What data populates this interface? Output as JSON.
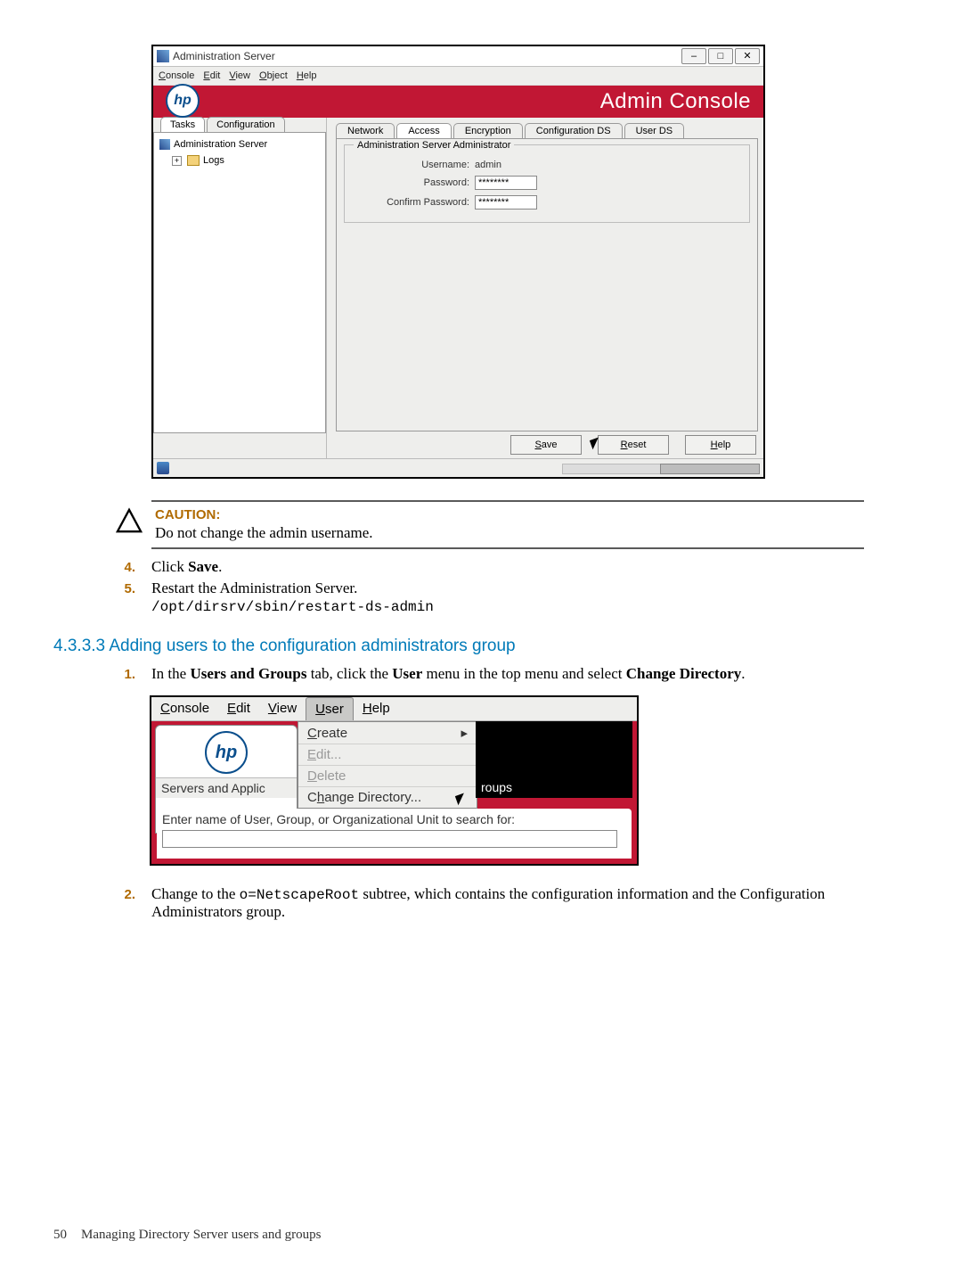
{
  "screenshot1": {
    "window_title": "Administration Server",
    "menubar": [
      "Console",
      "Edit",
      "View",
      "Object",
      "Help"
    ],
    "menubar_ul": [
      "C",
      "E",
      "V",
      "O",
      "H"
    ],
    "banner_text": "Admin Console",
    "side_tabs": {
      "active": "Tasks",
      "other": "Configuration"
    },
    "tree": {
      "root": "Administration Server",
      "child": "Logs"
    },
    "right_tabs": [
      "Network",
      "Access",
      "Encryption",
      "Configuration DS",
      "User DS"
    ],
    "fieldset_legend": "Administration Server Administrator",
    "username_label": "Username:",
    "username_value": "admin",
    "password_label": "Password:",
    "password_value": "********",
    "confirm_label": "Confirm Password:",
    "confirm_value": "********",
    "buttons": {
      "save": "Save",
      "reset": "Reset",
      "help": "Help"
    }
  },
  "caution": {
    "heading": "CAUTION:",
    "body": "Do not change the admin username."
  },
  "steps_a": {
    "s4_num": "4.",
    "s4_pre": "Click ",
    "s4_bold": "Save",
    "s4_post": ".",
    "s5_num": "5.",
    "s5_line": "Restart the Administration Server.",
    "s5_cmd": "/opt/dirsrv/sbin/restart-ds-admin"
  },
  "section_heading": "4.3.3.3 Adding users to the configuration administrators group",
  "steps_b": {
    "s1_num": "1.",
    "s1_a": "In the ",
    "s1_b": "Users and Groups",
    "s1_c": " tab, click the ",
    "s1_d": "User",
    "s1_e": " menu in the top menu and select ",
    "s1_f": "Change Directory",
    "s1_g": ".",
    "s2_num": "2.",
    "s2_a": "Change to the ",
    "s2_code": "o=NetscapeRoot",
    "s2_b": " subtree, which contains the configuration information and the Configuration Administrators group."
  },
  "screenshot2": {
    "menubar": [
      "Console",
      "Edit",
      "View",
      "User",
      "Help"
    ],
    "menubar_ul": [
      "C",
      "E",
      "V",
      "U",
      "H"
    ],
    "left_tab": "Servers and Applic",
    "dropdown": {
      "create": "Create",
      "edit": "Edit...",
      "delete": "Delete",
      "change": "Change Directory..."
    },
    "other_tab_suffix": "roups",
    "search_label": "Enter name of User, Group, or Organizational Unit to search for:"
  },
  "footer": {
    "pagenum": "50",
    "chapter": "Managing Directory Server users and groups"
  }
}
